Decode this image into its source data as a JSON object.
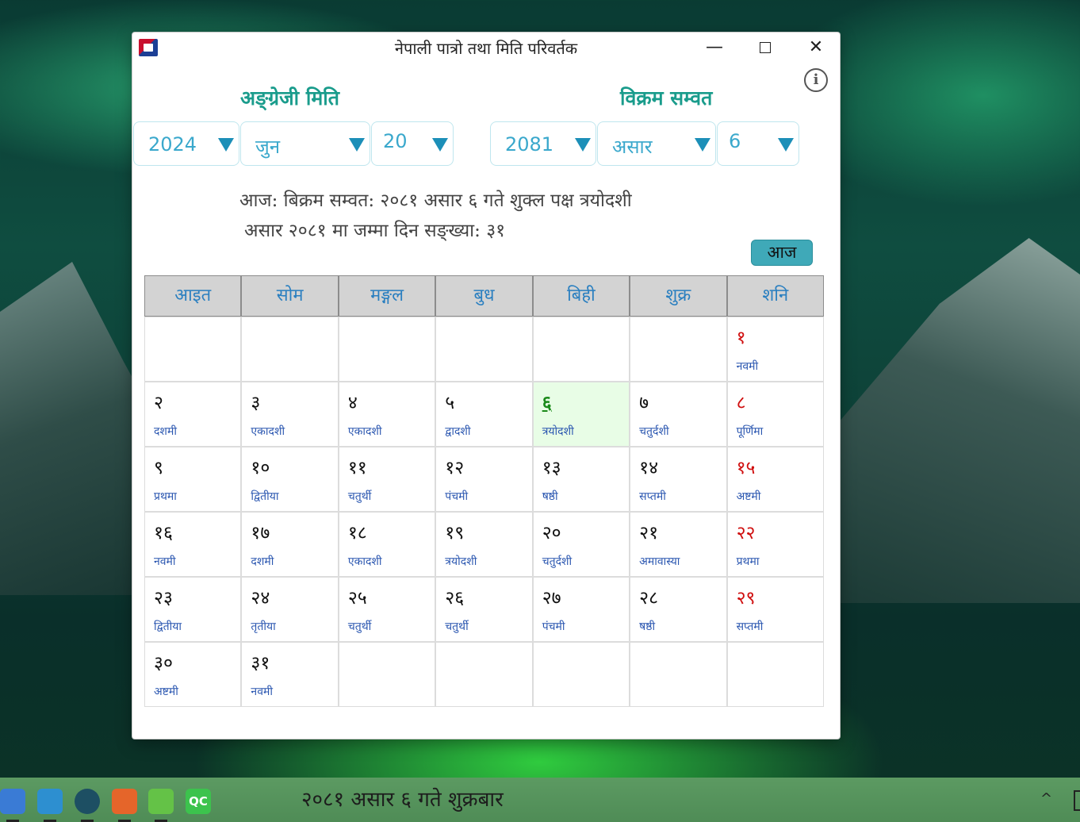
{
  "window": {
    "title": "नेपाली पात्रो तथा मिति परिवर्तक",
    "minimize": "—",
    "close": "✕",
    "info": "i"
  },
  "converter": {
    "ad_heading": "अङ्ग्रेजी मिति",
    "bs_heading": "विक्रम सम्वत",
    "ad_year": "2024",
    "ad_month": "जुन",
    "ad_day": "20",
    "bs_year": "2081",
    "bs_month": "असार",
    "bs_day": "6"
  },
  "today_info": "आज: बिक्रम सम्वत: २०८१ असार ६ गते शुक्ल पक्ष त्रयोदशी",
  "month_days_info": "असार २०८१ मा जम्मा दिन सङ्ख्या: ३१",
  "today_button": "आज",
  "weekdays": [
    "आइत",
    "सोम",
    "मङ्गल",
    "बुध",
    "बिही",
    "शुक्र",
    "शनि"
  ],
  "cells": [
    {
      "num": "",
      "tithi": ""
    },
    {
      "num": "",
      "tithi": ""
    },
    {
      "num": "",
      "tithi": ""
    },
    {
      "num": "",
      "tithi": ""
    },
    {
      "num": "",
      "tithi": ""
    },
    {
      "num": "",
      "tithi": ""
    },
    {
      "num": "१",
      "tithi": "नवमी"
    },
    {
      "num": "२",
      "tithi": "दशमी"
    },
    {
      "num": "३",
      "tithi": "एकादशी"
    },
    {
      "num": "४",
      "tithi": "एकादशी"
    },
    {
      "num": "५",
      "tithi": "द्वादशी"
    },
    {
      "num": "६",
      "tithi": "त्रयोदशी"
    },
    {
      "num": "७",
      "tithi": "चतुर्दशी"
    },
    {
      "num": "८",
      "tithi": "पूर्णिमा"
    },
    {
      "num": "९",
      "tithi": "प्रथमा"
    },
    {
      "num": "१०",
      "tithi": "द्वितीया"
    },
    {
      "num": "११",
      "tithi": "चतुर्थी"
    },
    {
      "num": "१२",
      "tithi": "पंचमी"
    },
    {
      "num": "१३",
      "tithi": "षष्ठी"
    },
    {
      "num": "१४",
      "tithi": "सप्तमी"
    },
    {
      "num": "१५",
      "tithi": "अष्टमी"
    },
    {
      "num": "१६",
      "tithi": "नवमी"
    },
    {
      "num": "१७",
      "tithi": "दशमी"
    },
    {
      "num": "१८",
      "tithi": "एकादशी"
    },
    {
      "num": "१९",
      "tithi": "त्रयोदशी"
    },
    {
      "num": "२०",
      "tithi": "चतुर्दशी"
    },
    {
      "num": "२१",
      "tithi": "अमावास्या"
    },
    {
      "num": "२२",
      "tithi": "प्रथमा"
    },
    {
      "num": "२३",
      "tithi": "द्वितीया"
    },
    {
      "num": "२४",
      "tithi": "तृतीया"
    },
    {
      "num": "२५",
      "tithi": "चतुर्थी"
    },
    {
      "num": "२६",
      "tithi": "चतुर्थी"
    },
    {
      "num": "२७",
      "tithi": "पंचमी"
    },
    {
      "num": "२८",
      "tithi": "षष्ठी"
    },
    {
      "num": "२९",
      "tithi": "सप्तमी"
    },
    {
      "num": "३०",
      "tithi": "अष्टमी"
    },
    {
      "num": "३१",
      "tithi": "नवमी"
    },
    {
      "num": "",
      "tithi": ""
    },
    {
      "num": "",
      "tithi": ""
    },
    {
      "num": "",
      "tithi": ""
    },
    {
      "num": "",
      "tithi": ""
    },
    {
      "num": "",
      "tithi": ""
    }
  ],
  "taskbar": {
    "date_text": "२०८१ असार ६ गते शुक्रबार",
    "qc_label": "QC",
    "chevron": "^"
  },
  "colors": {
    "heading": "#1a9c8c",
    "weekday_text": "#2a7fc0",
    "saturday": "#d01010",
    "today_cell": "#e8fde6",
    "today_button": "#3fa9b8"
  }
}
